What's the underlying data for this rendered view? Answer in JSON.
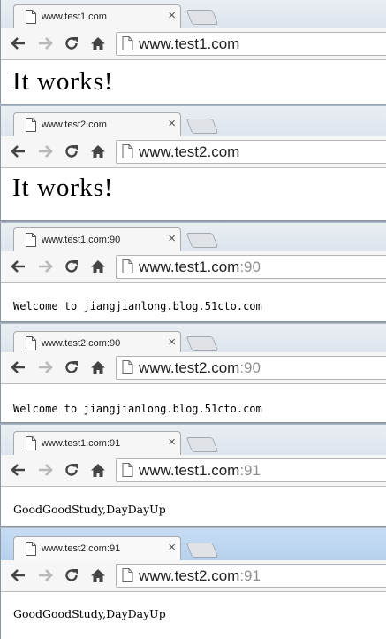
{
  "windows": [
    {
      "tab_title": "www.test1.com",
      "url_host": "www.test1.com",
      "url_port": "",
      "page_text": "It works!"
    },
    {
      "tab_title": "www.test2.com",
      "url_host": "www.test2.com",
      "url_port": "",
      "page_text": "It works!"
    },
    {
      "tab_title": "www.test1.com:90",
      "url_host": "www.test1.com",
      "url_port": ":90",
      "page_text": "Welcome to jiangjianlong.blog.51cto.com"
    },
    {
      "tab_title": "www.test2.com:90",
      "url_host": "www.test2.com",
      "url_port": ":90",
      "page_text": "Welcome to jiangjianlong.blog.51cto.com"
    },
    {
      "tab_title": "www.test1.com:91",
      "url_host": "www.test1.com",
      "url_port": ":91",
      "page_text": "GoodGoodStudy,DayDayUp"
    },
    {
      "tab_title": "www.test2.com:91",
      "url_host": "www.test2.com",
      "url_port": ":91",
      "page_text": "GoodGoodStudy,DayDayUp"
    }
  ],
  "toolbar": {
    "tab_close_glyph": "×",
    "back_icon": "arrow-left-icon",
    "forward_icon": "arrow-right-icon",
    "reload_icon": "reload-icon",
    "home_icon": "home-icon"
  },
  "colors": {
    "active_tabstrip": "#b6d1ee",
    "inactive_tabstrip": "#dde4ec",
    "url_port": "#8e8e8e"
  }
}
